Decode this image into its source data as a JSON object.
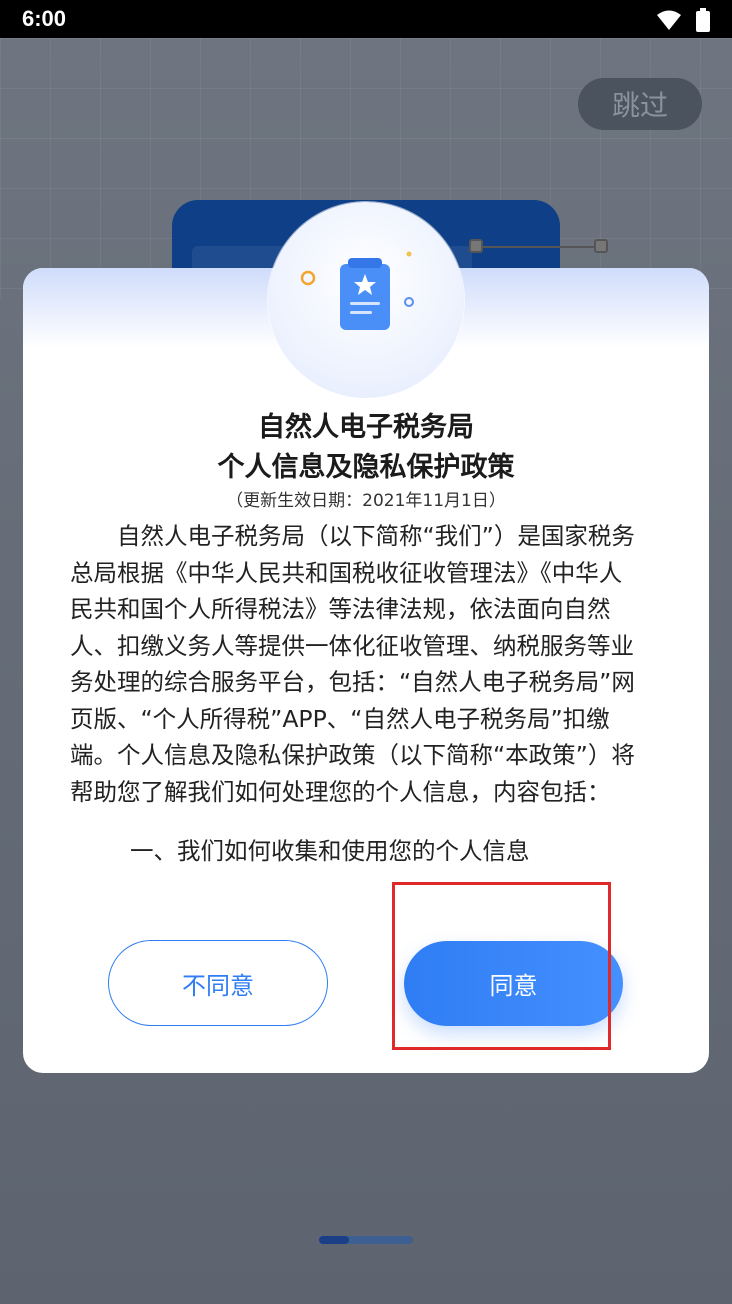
{
  "status_bar": {
    "time": "6:00"
  },
  "background": {
    "skip_label": "跳过"
  },
  "dialog": {
    "title_lines": [
      "自然人电子税务局",
      "个人信息及隐私保护政策"
    ],
    "update_date": "（更新生效日期：2021年11月1日）",
    "body_lines": [
      "　　自然人电子税务局（以下简称“我们”）是国家税务",
      "总局根据《中华人民共和国税收征收管理法》《中华人",
      "民共和国个人所得税法》等法律法规，依法面向自然",
      "人、扣缴义务人等提供一体化征收管理、纳税服务等业",
      "务处理的综合服务平台，包括：“自然人电子税务局”网",
      "页版、“个人所得税”APP、“自然人电子税务局”扣缴",
      "端。个人信息及隐私保护政策（以下简称“本政策”）将",
      "帮助您了解我们如何处理您的个人信息，内容包括："
    ],
    "section_title": "一、我们如何收集和使用您的个人信息",
    "disagree_label": "不同意",
    "agree_label": "同意"
  },
  "colors": {
    "accent": "#2f7df4",
    "highlight": "#e0292b",
    "overlay": "#5c6470"
  },
  "icons": [
    "wifi-icon",
    "battery-icon",
    "policy-document-icon"
  ]
}
